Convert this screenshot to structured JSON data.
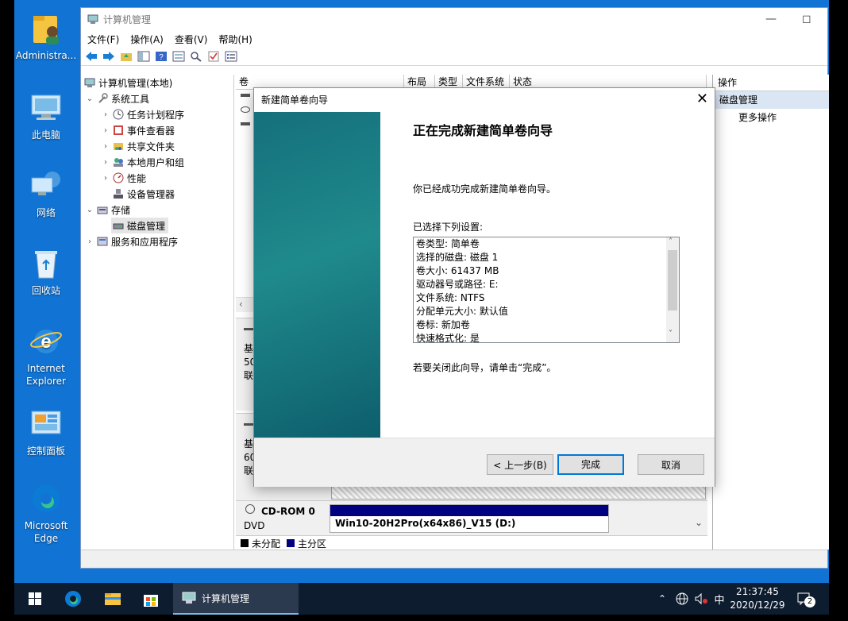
{
  "desktop": {
    "icons": [
      {
        "label": "Administra...",
        "icon": "user-folder-icon"
      },
      {
        "label": "此电脑",
        "icon": "computer-icon"
      },
      {
        "label": "网络",
        "icon": "network-icon"
      },
      {
        "label": "回收站",
        "icon": "recycle-bin-icon"
      },
      {
        "label": "Internet Explorer",
        "icon": "ie-icon"
      },
      {
        "label": "控制面板",
        "icon": "control-panel-icon"
      },
      {
        "label": "Microsoft Edge",
        "icon": "edge-icon"
      }
    ]
  },
  "window": {
    "title": "计算机管理",
    "menu": [
      "文件(F)",
      "操作(A)",
      "查看(V)",
      "帮助(H)"
    ],
    "tree": {
      "root": "计算机管理(本地)",
      "system_tools": "系统工具",
      "task_scheduler": "任务计划程序",
      "event_viewer": "事件查看器",
      "shared_folders": "共享文件夹",
      "local_users": "本地用户和组",
      "performance": "性能",
      "device_manager": "设备管理器",
      "storage": "存储",
      "disk_management": "磁盘管理",
      "services": "服务和应用程序"
    },
    "columns": [
      "卷",
      "布局",
      "类型",
      "文件系统",
      "状态"
    ],
    "disk_partial": {
      "d1a": "基",
      "d1b": "50",
      "d1c": "联",
      "d2a": "基",
      "d2b": "60",
      "d2c": "联"
    },
    "cdrom": {
      "name": "CD-ROM 0",
      "type": "DVD",
      "volume": "Win10-20H2Pro(x64x86)_V15  (D:)"
    },
    "legend": {
      "unallocated": "未分配",
      "primary": "主分区"
    },
    "actions": {
      "header": "操作",
      "section": "磁盘管理",
      "more": "更多操作"
    }
  },
  "wizard": {
    "title": "新建简单卷向导",
    "heading": "正在完成新建简单卷向导",
    "success": "你已经成功完成新建简单卷向导。",
    "selected_label": "已选择下列设置:",
    "settings": [
      "卷类型: 简单卷",
      "选择的磁盘: 磁盘 1",
      "卷大小: 61437 MB",
      "驱动器号或路径: E:",
      "文件系统: NTFS",
      "分配单元大小: 默认值",
      "卷标: 新加卷",
      "快速格式化: 是"
    ],
    "close_hint": "若要关闭此向导，请单击“完成”。",
    "back_button": "< 上一步(B)",
    "finish_button": "完成",
    "cancel_button": "取消"
  },
  "taskbar": {
    "active_app": "计算机管理",
    "ime": "中",
    "time": "21:37:45",
    "date": "2020/12/29",
    "notifications": "2"
  },
  "colors": {
    "desktop": "#1174d4",
    "accent": "#0078d7",
    "primary_partition": "#000080",
    "actions_highlight": "#dbe6f4"
  }
}
